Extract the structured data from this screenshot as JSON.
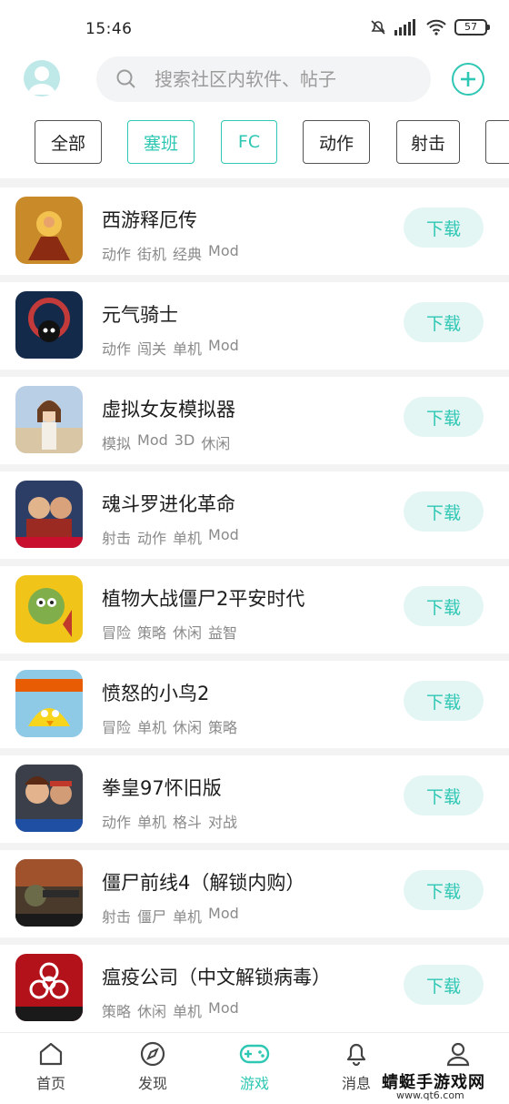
{
  "status_bar": {
    "time": "15:46",
    "battery": "57"
  },
  "search": {
    "placeholder": "搜索社区内软件、帖子"
  },
  "filters": [
    {
      "label": "全部",
      "active": false
    },
    {
      "label": "塞班",
      "active": true
    },
    {
      "label": "FC",
      "active": true
    },
    {
      "label": "动作",
      "active": false
    },
    {
      "label": "射击",
      "active": false
    }
  ],
  "download_label": "下载",
  "games": [
    {
      "name": "西游释厄传",
      "tags": [
        "动作",
        "街机",
        "经典",
        "Mod"
      ]
    },
    {
      "name": "元气骑士",
      "tags": [
        "动作",
        "闯关",
        "单机",
        "Mod"
      ]
    },
    {
      "name": "虚拟女友模拟器",
      "tags": [
        "模拟",
        "Mod",
        "3D",
        "休闲"
      ]
    },
    {
      "name": "魂斗罗进化革命",
      "tags": [
        "射击",
        "动作",
        "单机",
        "Mod"
      ]
    },
    {
      "name": "植物大战僵尸2平安时代",
      "tags": [
        "冒险",
        "策略",
        "休闲",
        "益智"
      ]
    },
    {
      "name": "愤怒的小鸟2",
      "tags": [
        "冒险",
        "单机",
        "休闲",
        "策略"
      ]
    },
    {
      "name": "拳皇97怀旧版",
      "tags": [
        "动作",
        "单机",
        "格斗",
        "对战"
      ]
    },
    {
      "name": "僵尸前线4（解锁内购）",
      "tags": [
        "射击",
        "僵尸",
        "单机",
        "Mod"
      ]
    },
    {
      "name": "瘟疫公司（中文解锁病毒）",
      "tags": [
        "策略",
        "休闲",
        "单机",
        "Mod"
      ]
    }
  ],
  "nav": {
    "home": "首页",
    "discover": "发现",
    "games": "游戏",
    "messages": "消息"
  },
  "watermark": {
    "title": "蜻蜓手游戏网",
    "url": "www.qt6.com"
  },
  "colors": {
    "accent": "#2ec7b3",
    "download_bg": "#e3f6f4"
  }
}
